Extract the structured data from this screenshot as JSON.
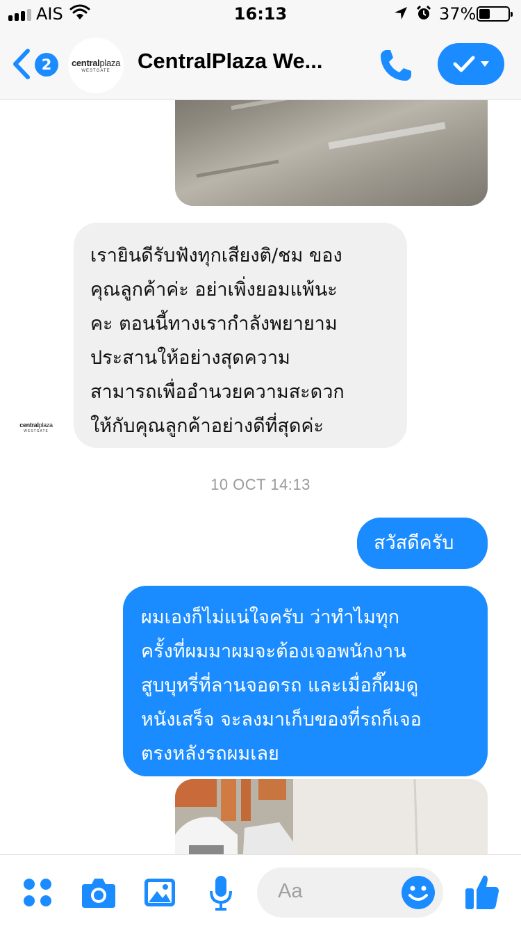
{
  "status_bar": {
    "carrier": "AIS",
    "time": "16:13",
    "battery_text": "37%",
    "battery_level": 0.37,
    "signal_bars_active": 3,
    "icons": [
      "wifi-icon",
      "location-arrow-icon",
      "alarm-clock-icon",
      "battery-icon"
    ]
  },
  "header": {
    "back_badge": "2",
    "title": "CentralPlaza We...",
    "logo": {
      "main_bold": "central",
      "main_thin": "plaza",
      "sub": "WESTGATE"
    },
    "icons": [
      "back-chevron-icon",
      "phone-icon",
      "checkmark-icon",
      "caret-down-icon"
    ]
  },
  "messages": {
    "incoming_text": "เรายินดีรับฟังทุกเสียงติ/ชม ของคุณลูกค้าค่ะ อย่าเพิ่งยอมแพ้นะคะ ตอนนี้ทางเรากำลังพยายามประสานให้อย่างสุดความสามารถเพื่ออำนวยความสะดวกให้กับคุณลูกค้าอย่างดีที่สุดค่ะ",
    "incoming_lines": [
      "เรายินดีรับฟังทุกเสียงติ/ชม ของ",
      "คุณลูกค้าค่ะ อย่าเพิ่งยอมแพ้นะ",
      "คะ ตอนนี้ทางเรากำลังพยายาม",
      "ประสานให้อย่างสุดความ",
      "สามารถเพื่ออำนวยความสะดวก",
      "ให้กับคุณลูกค้าอย่างดีที่สุดค่ะ"
    ],
    "timestamp": "10 OCT 14:13",
    "outgoing_1": "สวัสดีครับ",
    "outgoing_2_lines": [
      "ผมเองก็ไม่แน่ใจครับ ว่าทำไมทุก",
      "ครั้งที่ผมมาผมจะต้องเจอพนักงาน",
      "สูบบุหรี่ที่ลานจอดรถ และเมื่อกี๊ผมดู",
      "หนังเสร็จ จะลงมาเก็บของที่รถก็เจอ",
      "ตรงหลังรถผมเลย"
    ]
  },
  "composer": {
    "placeholder": "Aa",
    "icons": [
      "apps-grid-icon",
      "camera-icon",
      "photo-gallery-icon",
      "microphone-icon",
      "emoji-icon",
      "thumbs-up-icon"
    ]
  },
  "colors": {
    "accent": "#1a8cff",
    "incoming_bubble": "#f1f0f0",
    "header_bg": "#f7f7f7",
    "timestamp": "#9a9a9a"
  }
}
